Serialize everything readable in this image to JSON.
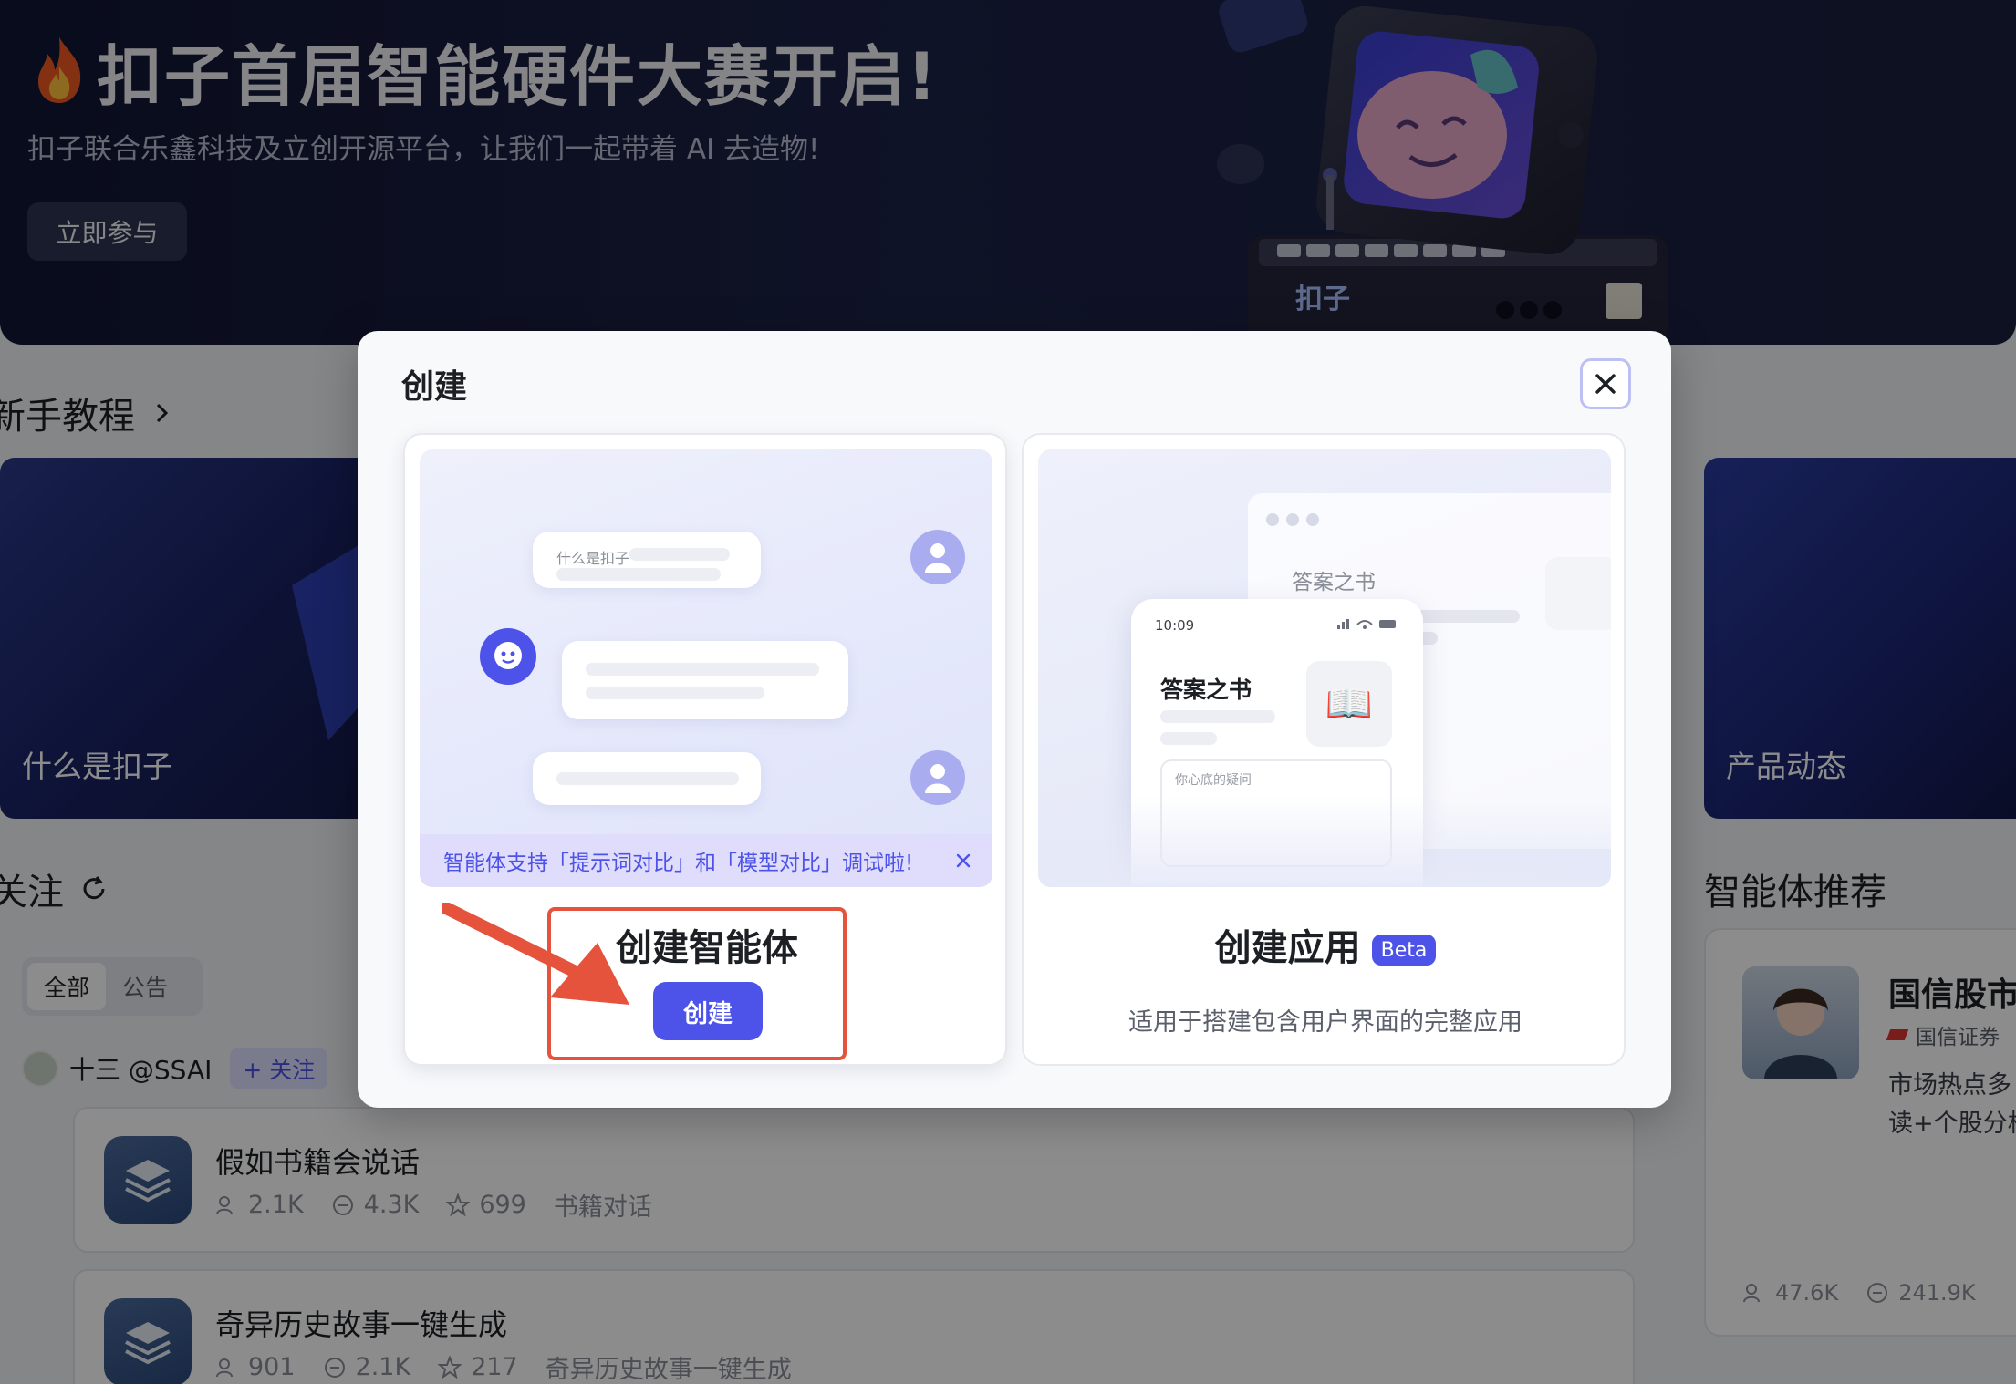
{
  "banner": {
    "title": "扣子首届智能硬件大赛开启!",
    "subtitle": "扣子联合乐鑫科技及立创开源平台，让我们一起带着 AI 去造物!",
    "cta_label": "立即参与",
    "device_logo": "扣子"
  },
  "tutorial": {
    "section_title": "新手教程",
    "cards": [
      {
        "label": "什么是扣子"
      },
      {
        "label": "产品动态"
      }
    ]
  },
  "following": {
    "section_title": "关注",
    "filters": [
      {
        "label": "全部",
        "active": true
      },
      {
        "label": "公告",
        "active": false
      }
    ],
    "author": {
      "name": "十三 @SSAI",
      "follow_label": "+ 关注"
    },
    "bots": [
      {
        "title": "假如书籍会说话",
        "users": "2.1K",
        "comments": "4.3K",
        "stars": "699",
        "tag": "书籍对话"
      },
      {
        "title": "奇异历史故事一键生成",
        "users": "901",
        "comments": "2.1K",
        "stars": "217",
        "tag": "奇异历史故事一键生成"
      }
    ]
  },
  "recommend": {
    "section_title": "智能体推荐",
    "card": {
      "title": "国信股市",
      "source": "国信证券",
      "desc": "市场热点多读+个股分析",
      "users": "47.6K",
      "comments": "241.9K"
    }
  },
  "modal": {
    "title": "创建",
    "close_icon": "close-icon",
    "agent_option": {
      "title": "创建智能体",
      "button_label": "创建",
      "preview_bubble_text": "什么是扣子",
      "notice": "智能体支持「提示词对比」和「模型对比」调试啦!"
    },
    "app_option": {
      "title": "创建应用",
      "badge": "Beta",
      "desc": "适用于搭建包含用户界面的完整应用",
      "preview_window_title": "答案之书",
      "preview_time": "10:09",
      "preview_phone_title": "答案之书",
      "preview_input_placeholder": "你心底的疑问"
    }
  },
  "colors": {
    "accent": "#4d53e8",
    "highlight": "#e5533d"
  }
}
